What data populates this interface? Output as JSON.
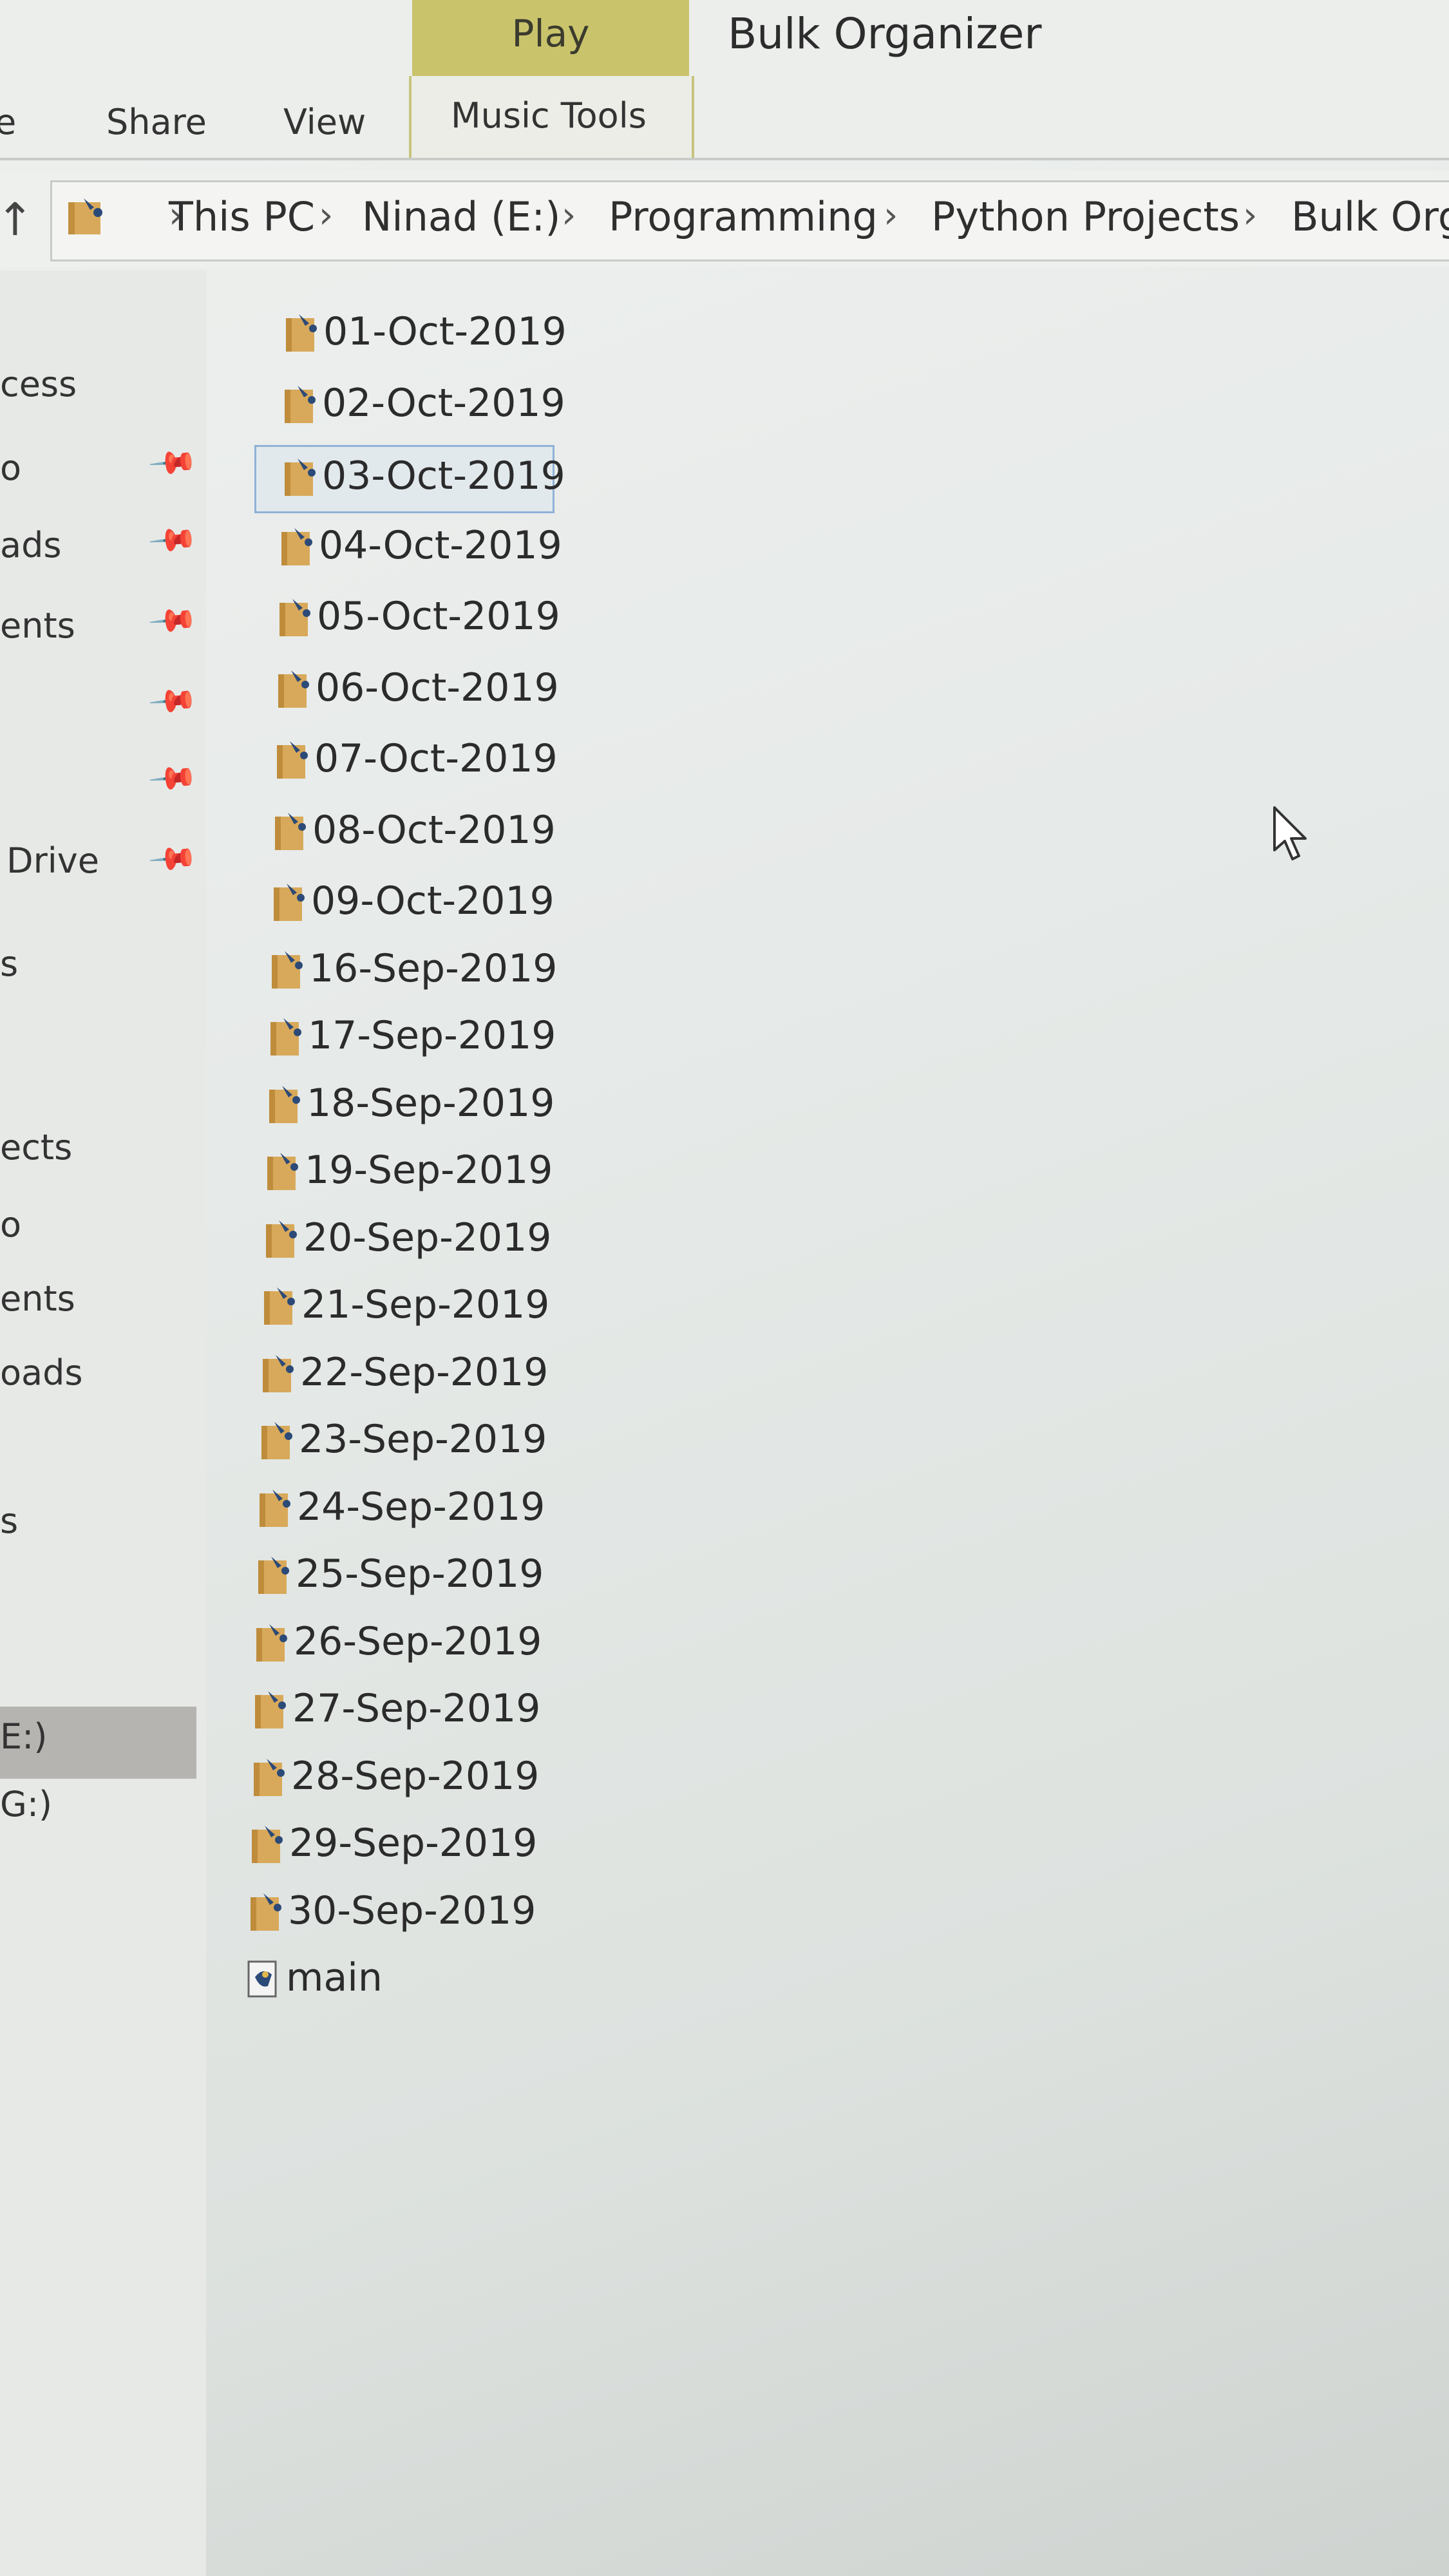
{
  "window": {
    "title": "Bulk Organizer"
  },
  "ribbon": {
    "contextual_group": "Play",
    "tabs": [
      {
        "label": "e"
      },
      {
        "label": "Share"
      },
      {
        "label": "View"
      },
      {
        "label": "Music Tools"
      }
    ]
  },
  "address": {
    "up_icon": "up-arrow-icon",
    "breadcrumbs": [
      "This PC",
      "Ninad (E:)",
      "Programming",
      "Python Projects",
      "Bulk Org"
    ]
  },
  "nav": {
    "items": [
      {
        "label": "cess"
      },
      {
        "label": "o"
      },
      {
        "label": "ads"
      },
      {
        "label": "ents"
      },
      {
        "label": ""
      },
      {
        "label": ""
      },
      {
        "label": "Drive"
      },
      {
        "label": "s"
      },
      {
        "label": "ects"
      },
      {
        "label": "o"
      },
      {
        "label": "ents"
      },
      {
        "label": "oads"
      },
      {
        "label": "s"
      },
      {
        "label": "E:)"
      },
      {
        "label": "G:)"
      }
    ]
  },
  "files": [
    {
      "name": "01-Oct-2019",
      "type": "folder"
    },
    {
      "name": "02-Oct-2019",
      "type": "folder"
    },
    {
      "name": "03-Oct-2019",
      "type": "folder",
      "selected": true
    },
    {
      "name": "04-Oct-2019",
      "type": "folder"
    },
    {
      "name": "05-Oct-2019",
      "type": "folder"
    },
    {
      "name": "06-Oct-2019",
      "type": "folder"
    },
    {
      "name": "07-Oct-2019",
      "type": "folder"
    },
    {
      "name": "08-Oct-2019",
      "type": "folder"
    },
    {
      "name": "09-Oct-2019",
      "type": "folder"
    },
    {
      "name": "16-Sep-2019",
      "type": "folder"
    },
    {
      "name": "17-Sep-2019",
      "type": "folder"
    },
    {
      "name": "18-Sep-2019",
      "type": "folder"
    },
    {
      "name": "19-Sep-2019",
      "type": "folder"
    },
    {
      "name": "20-Sep-2019",
      "type": "folder"
    },
    {
      "name": "21-Sep-2019",
      "type": "folder"
    },
    {
      "name": "22-Sep-2019",
      "type": "folder"
    },
    {
      "name": "23-Sep-2019",
      "type": "folder"
    },
    {
      "name": "24-Sep-2019",
      "type": "folder"
    },
    {
      "name": "25-Sep-2019",
      "type": "folder"
    },
    {
      "name": "26-Sep-2019",
      "type": "folder"
    },
    {
      "name": "27-Sep-2019",
      "type": "folder"
    },
    {
      "name": "28-Sep-2019",
      "type": "folder"
    },
    {
      "name": "29-Sep-2019",
      "type": "folder"
    },
    {
      "name": "30-Sep-2019",
      "type": "folder"
    },
    {
      "name": "main",
      "type": "python-file"
    }
  ],
  "colors": {
    "play_band": "#c9c36c",
    "folder": "#d8a95a",
    "selection_border": "#8fb2d8"
  }
}
